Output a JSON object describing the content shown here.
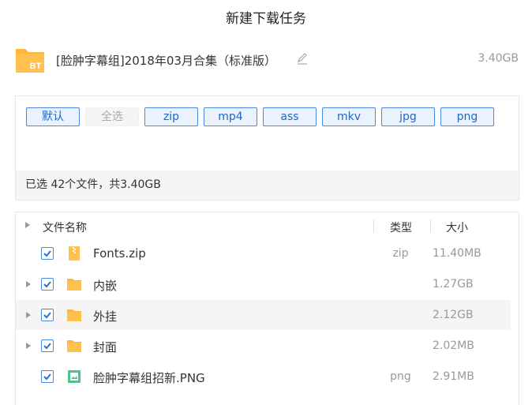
{
  "dialog": {
    "title": "新建下载任务"
  },
  "task": {
    "icon_label": "BT",
    "name": "[脸肿字幕组]2018年03月合集（标准版）",
    "size": "3.40GB"
  },
  "filters": {
    "buttons": [
      {
        "label": "默认",
        "state": "active"
      },
      {
        "label": "全选",
        "state": "disabled"
      },
      {
        "label": "zip",
        "state": "active"
      },
      {
        "label": "mp4",
        "state": "active"
      },
      {
        "label": "ass",
        "state": "active"
      },
      {
        "label": "mkv",
        "state": "active"
      },
      {
        "label": "jpg",
        "state": "active"
      },
      {
        "label": "png",
        "state": "active"
      }
    ],
    "status": "已选 42个文件，共3.40GB"
  },
  "table": {
    "headers": {
      "name": "文件名称",
      "type": "类型",
      "size": "大小"
    },
    "rows": [
      {
        "name": "Fonts.zip",
        "type": "zip",
        "size": "11.40MB",
        "icon": "zip-file-icon",
        "expandable": false,
        "checked": true
      },
      {
        "name": "内嵌",
        "type": "",
        "size": "1.27GB",
        "icon": "folder-icon",
        "expandable": true,
        "checked": true
      },
      {
        "name": "外挂",
        "type": "",
        "size": "2.12GB",
        "icon": "folder-icon",
        "expandable": true,
        "checked": true,
        "highlighted": true
      },
      {
        "name": "封面",
        "type": "",
        "size": "2.02MB",
        "icon": "folder-icon",
        "expandable": true,
        "checked": true
      },
      {
        "name": "脸肿字幕组招新.PNG",
        "type": "png",
        "size": "2.91MB",
        "icon": "image-file-icon",
        "expandable": false,
        "checked": true
      }
    ]
  },
  "colors": {
    "accent": "#4a89dc",
    "folder": "#ffc14d",
    "image_file": "#4cc38a"
  }
}
